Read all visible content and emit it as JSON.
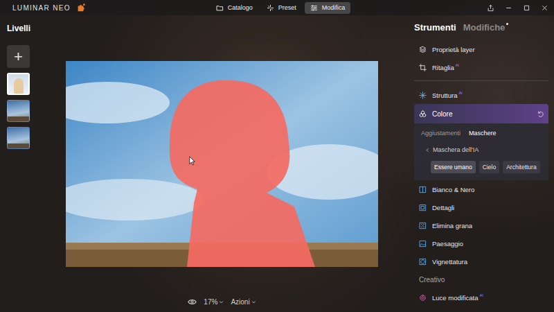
{
  "app": {
    "logo": "LUMINAR NEO"
  },
  "nav_tabs": [
    {
      "label": "Catalogo",
      "selected": false
    },
    {
      "label": "Preset",
      "selected": false
    },
    {
      "label": "Modifica",
      "selected": true
    }
  ],
  "layers": {
    "title": "Livelli",
    "add_button": "+",
    "items": [
      {
        "kind": "portrait",
        "selected": true
      },
      {
        "kind": "sky",
        "selected": false
      },
      {
        "kind": "sky",
        "selected": false
      }
    ]
  },
  "view_bar": {
    "zoom": "17%",
    "actions": "Azioni"
  },
  "panel_tabs": [
    {
      "label": "Strumenti",
      "selected": true,
      "modified": false
    },
    {
      "label": "Modifiche",
      "selected": false,
      "modified": true
    }
  ],
  "tools": [
    {
      "kind": "tool",
      "label": "Proprietà layer",
      "badge": "",
      "expanded": false,
      "color": "#d8d8d8"
    },
    {
      "kind": "tool",
      "label": "Ritaglia",
      "badge": "AI",
      "expanded": false,
      "color": "#d8d8d8"
    },
    {
      "kind": "divider"
    },
    {
      "kind": "tool",
      "label": "Struttura",
      "badge": "AI",
      "expanded": false,
      "color": "#4fa3f0"
    },
    {
      "kind": "tool",
      "label": "Colore",
      "badge": "",
      "expanded": true,
      "color": "#ffffff",
      "panel": {
        "subtabs": [
          {
            "label": "Aggiustamenti",
            "selected": false
          },
          {
            "label": "Maschere",
            "selected": true
          }
        ],
        "mask_title": "Maschera dell'IA",
        "chips": [
          {
            "label": "Essere umano",
            "selected": true
          },
          {
            "label": "Cielo",
            "selected": false
          },
          {
            "label": "Architettura",
            "selected": false
          }
        ]
      }
    },
    {
      "kind": "tool",
      "label": "Bianco & Nero",
      "badge": "",
      "expanded": false,
      "color": "#4fa3f0"
    },
    {
      "kind": "tool",
      "label": "Dettagli",
      "badge": "",
      "expanded": false,
      "color": "#4fa3f0"
    },
    {
      "kind": "tool",
      "label": "Elimina grana",
      "badge": "",
      "expanded": false,
      "color": "#4fa3f0"
    },
    {
      "kind": "tool",
      "label": "Paesaggio",
      "badge": "",
      "expanded": false,
      "color": "#4fa3f0"
    },
    {
      "kind": "tool",
      "label": "Vignettatura",
      "badge": "",
      "expanded": false,
      "color": "#4fa3f0"
    },
    {
      "kind": "heading",
      "label": "Creativo"
    },
    {
      "kind": "tool",
      "label": "Luce modificata",
      "badge": "AI",
      "expanded": false,
      "color": "#e45fb8"
    }
  ]
}
